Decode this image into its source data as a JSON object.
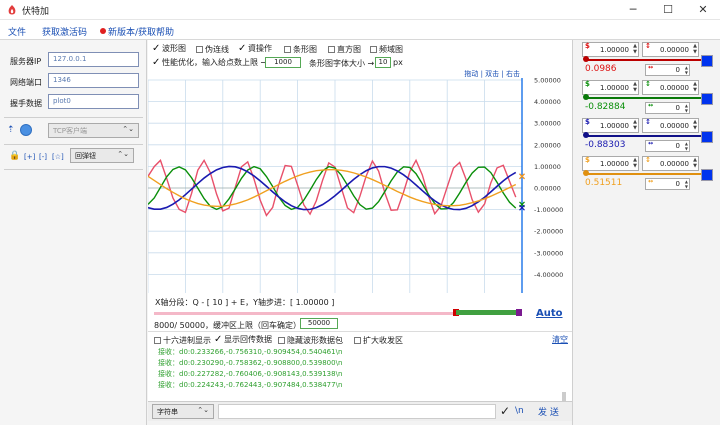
{
  "window": {
    "title": "伏特加",
    "minimize": "─",
    "maximize": "☐",
    "close": "✕"
  },
  "menu": {
    "file": "文件",
    "activate": "获取激活码",
    "help": "新版本/获取帮助"
  },
  "connection": {
    "server_label": "服务器IP",
    "server_value": "127.0.0.1",
    "port_label": "网络端口",
    "port_value": "1346",
    "handshake_label": "握手数据",
    "handshake_value": "plot0",
    "mode": "TCP客户端",
    "toolbar_buttons": [
      "[+]",
      "[-]",
      "[☆]"
    ],
    "popup_mode": "回弹钮"
  },
  "plot_toolbar": {
    "checkboxes": [
      {
        "label": "波形图",
        "checked": true
      },
      {
        "label": "伪连线",
        "checked": false
      },
      {
        "label": "資操作",
        "checked": true
      },
      {
        "label": "条形图",
        "checked": false
      },
      {
        "label": "直方图",
        "checked": false
      },
      {
        "label": "频域图",
        "checked": false
      }
    ],
    "perf_label": "性能优化，输入给点数上限 →",
    "perf_checked": true,
    "perf_value": "1000",
    "bar_font_label": "条形图字体大小 →",
    "bar_font_value": "10",
    "bar_font_unit": "px"
  },
  "plot_hint": "拖动 | 双击 | 右击",
  "y_ticks": [
    "5.00000",
    "4.00000",
    "3.00000",
    "2.00000",
    "1.00000",
    "0.00000",
    "-1.00000",
    "-2.00000",
    "-3.00000",
    "-4.00000",
    "-5.00000"
  ],
  "chart_data": {
    "type": "line",
    "x": [
      0,
      1,
      2,
      3,
      4,
      5,
      6,
      7,
      8,
      9,
      10,
      11,
      12,
      13,
      14,
      15,
      16,
      17,
      18,
      19,
      20,
      21,
      22,
      23,
      24,
      25,
      26,
      27,
      28,
      29,
      30,
      31,
      32,
      33,
      34,
      35,
      36,
      37,
      38,
      39,
      40,
      41,
      42,
      43,
      44,
      45,
      46,
      47,
      48,
      49,
      50,
      51,
      52,
      53,
      54,
      55,
      56,
      57,
      58,
      59,
      60
    ],
    "ylim": [
      -5,
      5
    ],
    "grid": true,
    "series": [
      {
        "color": "#e8506a",
        "values": [
          0.54,
          0.99,
          1.28,
          0.44,
          -0.46,
          -0.99,
          -1.13,
          -0.24,
          0.83,
          1.28,
          0.71,
          -0.28,
          -1.06,
          -0.93,
          0.03,
          0.98,
          1.21,
          0.42,
          -0.56,
          -1.27,
          -0.9,
          0.18,
          1.04,
          1.0,
          0.13,
          -0.78,
          -1.21,
          -0.59,
          0.35,
          1.16,
          0.97,
          0.02,
          -0.92,
          -1.14,
          -0.38,
          0.55,
          1.25,
          0.78,
          -0.23,
          -1.03,
          -1.01,
          -0.19,
          0.75,
          1.28,
          0.61,
          -0.37,
          -1.19,
          -0.83,
          0.05,
          0.92,
          1.18,
          0.42,
          -0.54,
          -1.12,
          -0.74,
          0.24,
          0.93,
          1.05,
          0.31,
          -0.42,
          0.54
        ]
      },
      {
        "color": "#0a8f0a",
        "values": [
          -0.76,
          -0.46,
          0.03,
          0.52,
          0.86,
          0.98,
          0.84,
          0.47,
          -0.01,
          -0.49,
          -0.85,
          -0.99,
          -0.86,
          -0.5,
          -0.04,
          0.45,
          0.83,
          0.99,
          0.89,
          0.53,
          0.07,
          -0.43,
          -0.81,
          -0.99,
          -0.9,
          -0.56,
          -0.1,
          0.39,
          0.79,
          0.99,
          0.92,
          0.6,
          0.13,
          -0.36,
          -0.77,
          -0.98,
          -0.93,
          -0.63,
          -0.16,
          0.33,
          0.74,
          0.98,
          0.95,
          0.66,
          0.2,
          -0.3,
          -0.72,
          -0.97,
          -0.96,
          -0.68,
          -0.23,
          0.26,
          0.69,
          0.96,
          0.97,
          0.71,
          0.26,
          -0.23,
          -0.66,
          -0.93,
          -0.76
        ]
      },
      {
        "color": "#1a1ab0",
        "values": [
          -0.91,
          -0.98,
          -0.98,
          -0.9,
          -0.75,
          -0.55,
          -0.31,
          -0.05,
          0.21,
          0.46,
          0.67,
          0.84,
          0.95,
          1.0,
          0.98,
          0.89,
          0.75,
          0.56,
          0.33,
          0.08,
          -0.18,
          -0.42,
          -0.64,
          -0.82,
          -0.94,
          -1.0,
          -0.99,
          -0.91,
          -0.77,
          -0.58,
          -0.36,
          -0.11,
          0.15,
          0.4,
          0.62,
          0.8,
          0.93,
          0.99,
          0.99,
          0.92,
          0.79,
          0.61,
          0.39,
          0.14,
          -0.12,
          -0.37,
          -0.59,
          -0.78,
          -0.92,
          -0.99,
          -1.0,
          -0.94,
          -0.82,
          -0.64,
          -0.43,
          -0.18,
          0.08,
          0.33,
          0.55,
          0.72,
          -0.91
        ]
      },
      {
        "color": "#f0a020",
        "values": [
          0.54,
          0.35,
          0.16,
          -0.03,
          -0.2,
          -0.36,
          -0.5,
          -0.62,
          -0.72,
          -0.79,
          -0.83,
          -0.85,
          -0.84,
          -0.8,
          -0.74,
          -0.65,
          -0.55,
          -0.42,
          -0.28,
          -0.13,
          0.02,
          0.17,
          0.31,
          0.44,
          0.56,
          0.66,
          0.74,
          0.8,
          0.83,
          0.85,
          0.85,
          0.82,
          0.77,
          0.7,
          0.61,
          0.51,
          0.39,
          0.26,
          0.12,
          -0.02,
          -0.16,
          -0.29,
          -0.42,
          -0.53,
          -0.62,
          -0.7,
          -0.76,
          -0.8,
          -0.82,
          -0.82,
          -0.8,
          -0.75,
          -0.68,
          -0.6,
          -0.5,
          -0.38,
          -0.25,
          -0.12,
          0.02,
          0.16,
          0.54
        ]
      }
    ]
  },
  "controls": {
    "x_axis": "X轴分段：Q - [ 10 ] + E，Y轴步进：[ 1.00000 ]",
    "buffer_label": "8000/ 50000，缓冲区上限（回车确定）→",
    "buffer_value": "50000",
    "auto": "Auto"
  },
  "recv": {
    "options": [
      {
        "label": "十六进制显示",
        "checked": false
      },
      {
        "label": "显示回传数据",
        "checked": true
      },
      {
        "label": "隐藏波形数据包",
        "checked": false
      },
      {
        "label": "扩大收发区",
        "checked": false
      }
    ],
    "clear": "清空",
    "lines": [
      "接收：d0:0.233266,-0.756310,-0.909454,0.540461\\n",
      "接收：d0:0.230290,-0.758362,-0.908800,0.539800\\n",
      "接收：d0:0.227282,-0.760406,-0.908143,0.539138\\n",
      "接收：d0:0.224243,-0.762443,-0.907484,0.538477\\n"
    ]
  },
  "send": {
    "format": "字符串",
    "newline": "\\n",
    "button": "发 送"
  },
  "channels": [
    {
      "scale": "1.00000",
      "offset": "0.00000",
      "value": "0.0986",
      "sub": "0",
      "color": "#d11",
      "line": "#b00",
      "sw": "#0033ee"
    },
    {
      "scale": "1.00000",
      "offset": "0.00000",
      "value": "-0.82884",
      "sub": "0",
      "color": "#0a8f0a",
      "line": "#0a7a0a",
      "sw": "#0033ee"
    },
    {
      "scale": "1.00000",
      "offset": "0.00000",
      "value": "-0.88303",
      "sub": "0",
      "color": "#1a1ab0",
      "line": "#111188",
      "sw": "#0033ee"
    },
    {
      "scale": "1.00000",
      "offset": "0.00000",
      "value": "0.51511",
      "sub": "0",
      "color": "#f0a020",
      "line": "#e09010",
      "sw": "#0033ee"
    }
  ]
}
